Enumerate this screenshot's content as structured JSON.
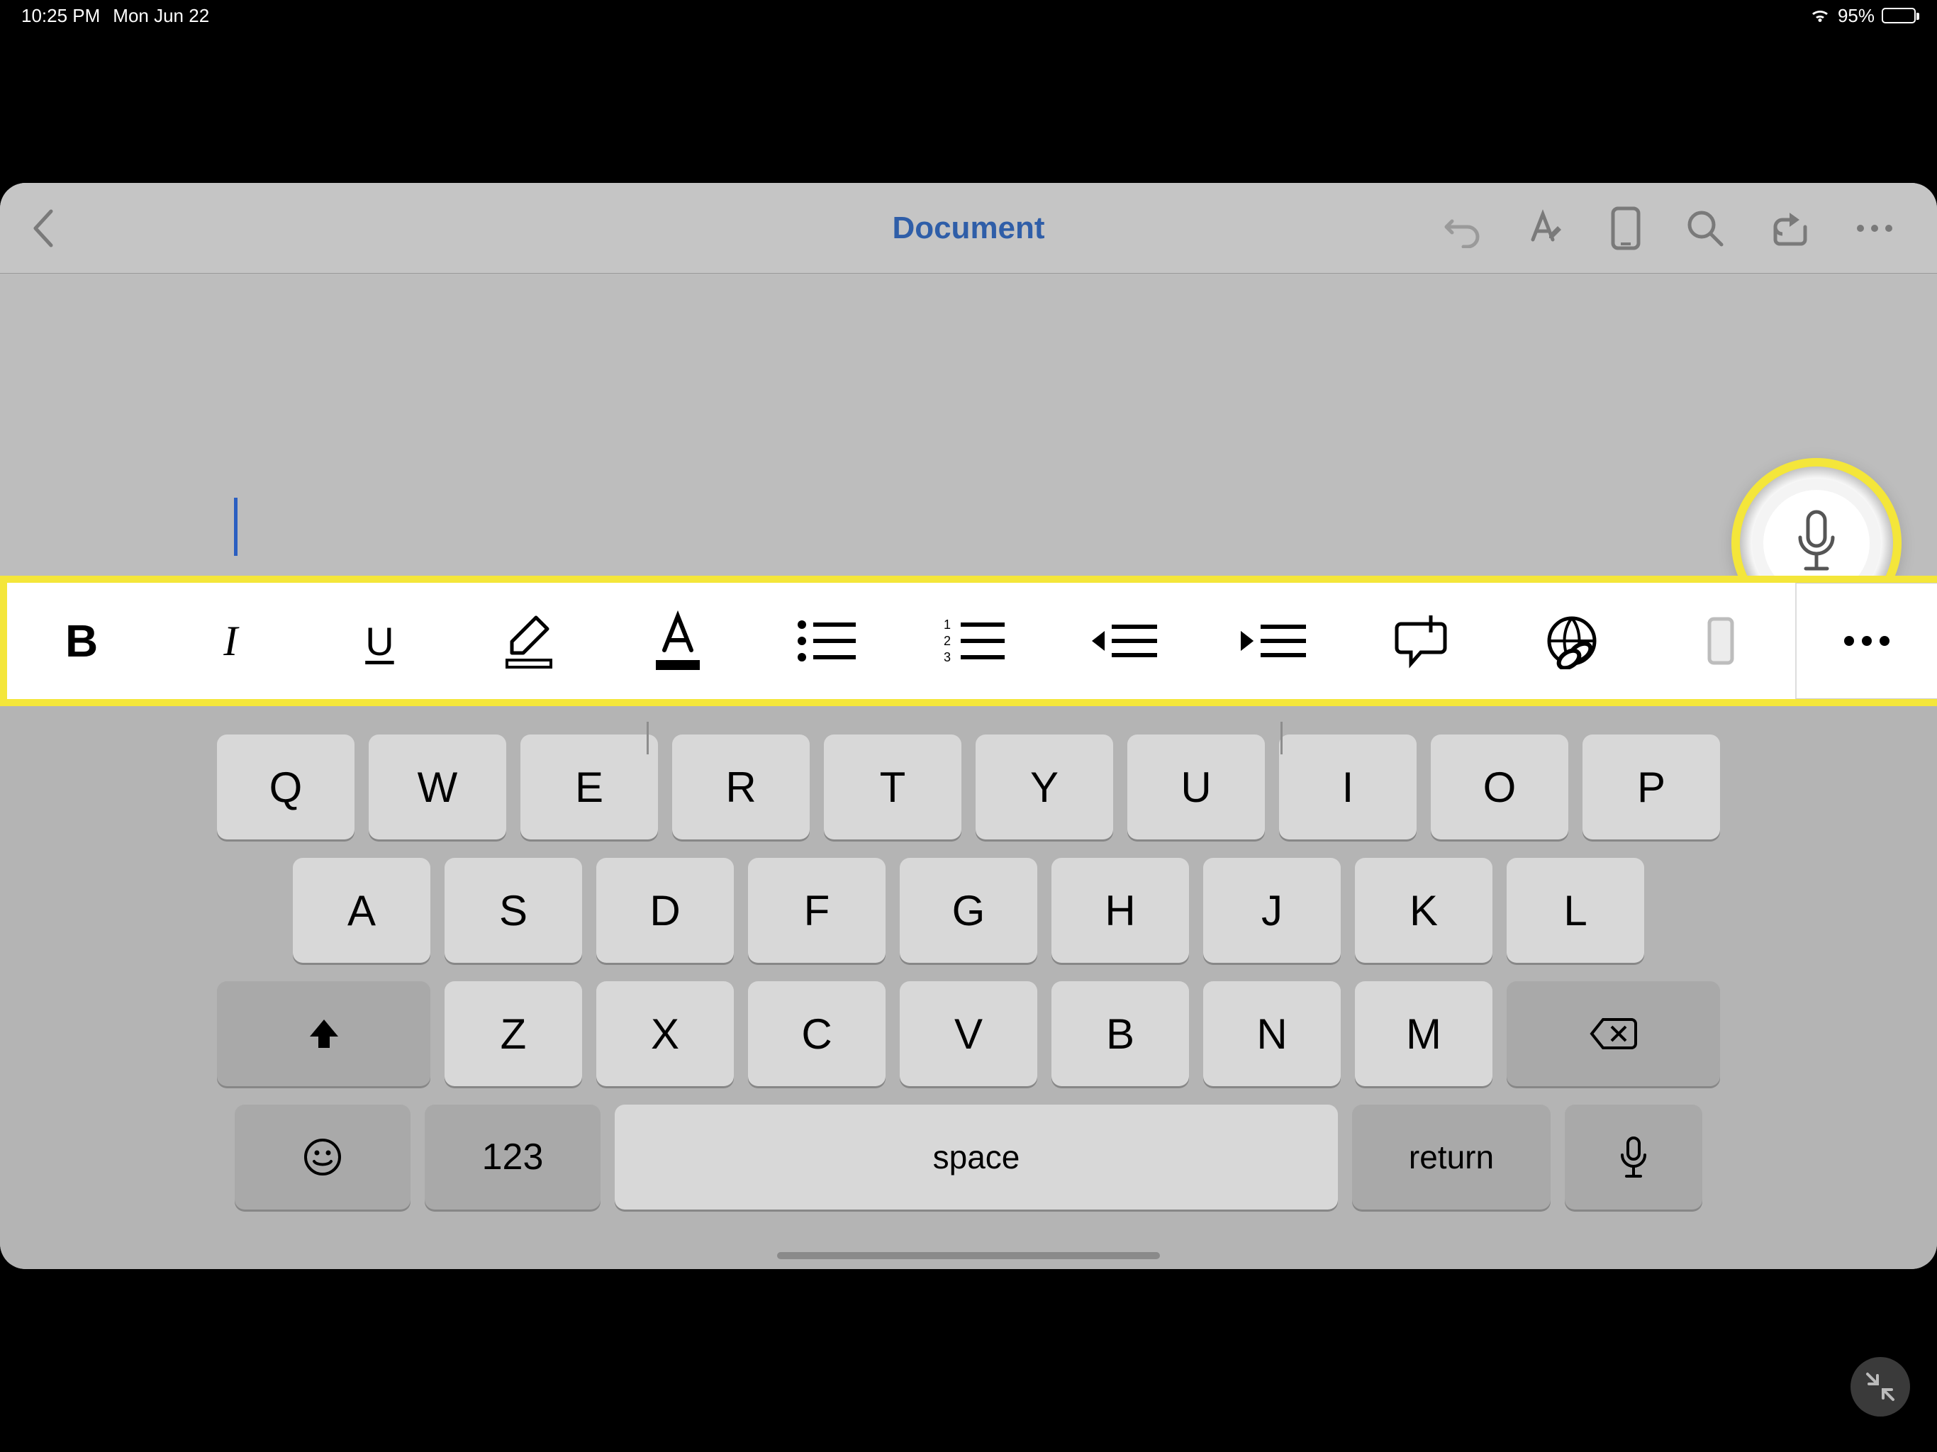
{
  "status": {
    "time": "10:25 PM",
    "date": "Mon Jun 22",
    "battery_pct": "95%"
  },
  "doc": {
    "title": "Document"
  },
  "ribbon": {
    "bold": "B",
    "italic": "I",
    "underline": "U"
  },
  "keyboard": {
    "row1": [
      "Q",
      "W",
      "E",
      "R",
      "T",
      "Y",
      "U",
      "I",
      "O",
      "P"
    ],
    "row2": [
      "A",
      "S",
      "D",
      "F",
      "G",
      "H",
      "J",
      "K",
      "L"
    ],
    "row3": [
      "Z",
      "X",
      "C",
      "V",
      "B",
      "N",
      "M"
    ],
    "numbers": "123",
    "space": "space",
    "return": "return"
  },
  "highlight": {
    "color": "#f4e63a"
  }
}
